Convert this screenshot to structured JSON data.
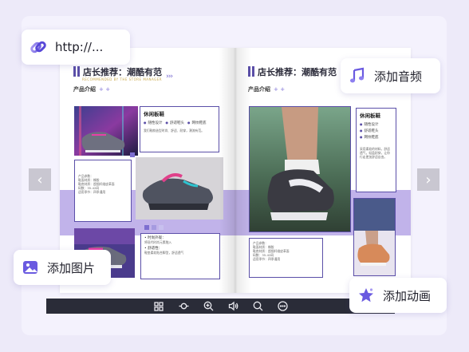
{
  "chips": {
    "url": "http://...",
    "audio": "添加音频",
    "image": "添加图片",
    "animation": "添加动画"
  },
  "left_page": {
    "title": "店长推荐：潮酷有范",
    "subtitle": "RECOMMENDED BY THE STORE MANAGER",
    "intro": "产品介绍",
    "card_title": "休闲板鞋",
    "card_items": [
      "随性设计",
      "舒适鞋头",
      "网纹鞋底"
    ],
    "card_text": "我们鞋款造型时尚、舒适、耐穿，潮流有范。",
    "spec": [
      "产品参数：",
      "鞋面材质：橡胶",
      "鞋底材质：超细纤维皮革面",
      "码数：35-42码",
      "适用季节：四季通用"
    ],
    "bottom_lines": [
      "• 时尚外观：",
      "将现代时尚元素融入",
      "• 舒适性：",
      "鞋垫柔软贴合脚型，舒适透气"
    ]
  },
  "right_page": {
    "title": "店长推荐：潮酷有范",
    "intro": "产品介绍",
    "card_title": "休闲板鞋",
    "card_items": [
      "随性设计",
      "舒适鞋头",
      "网纹鞋底"
    ],
    "card_text": "采用柔软的材料，舒适透气，轻盈耐穿，让你行走更加舒适自由。",
    "spec": [
      "产品参数：",
      "鞋面材质：橡胶",
      "鞋底材质：超细纤维皮革面",
      "码数：35-42码",
      "适用季节：四季通用"
    ]
  },
  "colors": {
    "accent": "#5b4fa8",
    "band": "#b6a6e6",
    "toolbar": "#2a2c38"
  }
}
